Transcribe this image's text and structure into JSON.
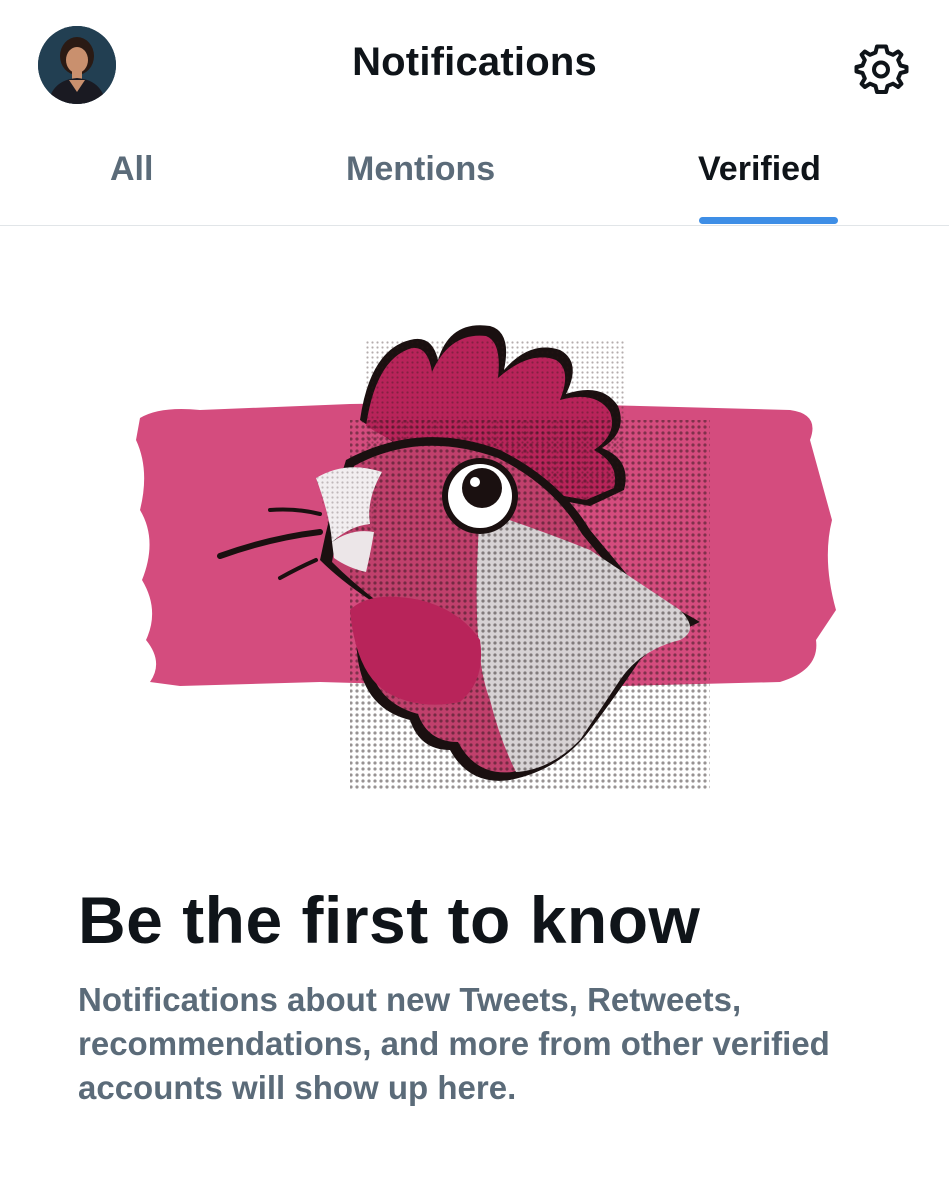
{
  "header": {
    "title": "Notifications",
    "avatar_icon": "user-avatar",
    "settings_icon": "gear-icon"
  },
  "tabs": [
    {
      "label": "All",
      "active": false
    },
    {
      "label": "Mentions",
      "active": false
    },
    {
      "label": "Verified",
      "active": true
    }
  ],
  "empty_state": {
    "illustration": "rooster-icon",
    "headline": "Be the first to know",
    "body": "Notifications about new Tweets, Retweets, recommendations, and more from other verified accounts will show up here."
  },
  "colors": {
    "accent": "#3e8ee6",
    "text_primary": "#0f1419",
    "text_secondary": "#5b6b79",
    "illustration_pink": "#d44c7e",
    "divider": "#e1e5e8"
  }
}
